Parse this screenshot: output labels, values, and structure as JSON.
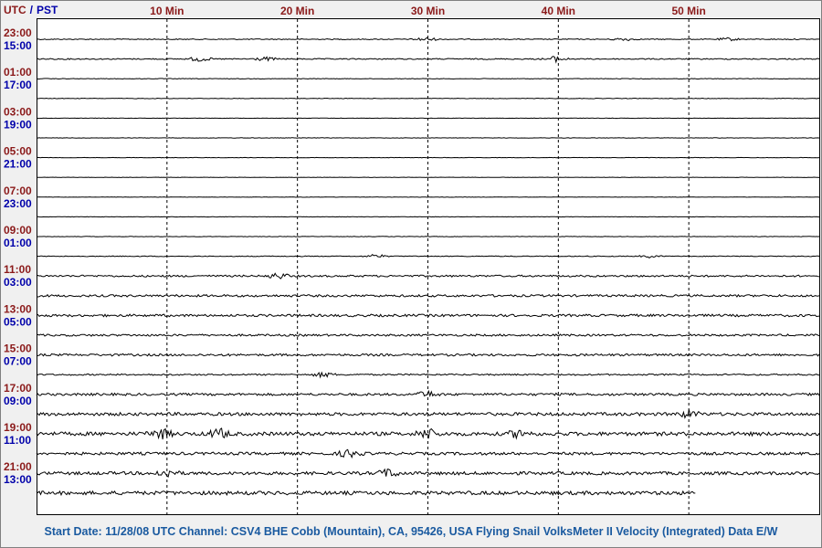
{
  "header": {
    "utc_label": "UTC",
    "sep": "/",
    "pst_label": "PST"
  },
  "colors": {
    "utc": "#8b1a1a",
    "pst": "#0000aa",
    "minute": "#8b1a1a",
    "trace": "#000000",
    "footer": "#1a5aa0"
  },
  "chart_data": {
    "type": "line",
    "title": "",
    "xlabel": "",
    "ylabel": "",
    "x_unit": "minutes",
    "xlim": [
      0,
      60
    ],
    "grid_minutes": [
      10,
      20,
      30,
      40,
      50
    ],
    "minute_labels": [
      "10 Min",
      "20 Min",
      "30 Min",
      "40 Min",
      "50 Min"
    ],
    "row_count": 24,
    "last_row_end_minute": 50.5,
    "hour_labels": [
      {
        "row": 0,
        "utc": "23:00",
        "pst": "15:00"
      },
      {
        "row": 2,
        "utc": "01:00",
        "pst": "17:00"
      },
      {
        "row": 4,
        "utc": "03:00",
        "pst": "19:00"
      },
      {
        "row": 6,
        "utc": "05:00",
        "pst": "21:00"
      },
      {
        "row": 8,
        "utc": "07:00",
        "pst": "23:00"
      },
      {
        "row": 10,
        "utc": "09:00",
        "pst": "01:00"
      },
      {
        "row": 12,
        "utc": "11:00",
        "pst": "03:00"
      },
      {
        "row": 14,
        "utc": "13:00",
        "pst": "05:00"
      },
      {
        "row": 16,
        "utc": "15:00",
        "pst": "07:00"
      },
      {
        "row": 18,
        "utc": "17:00",
        "pst": "09:00"
      },
      {
        "row": 20,
        "utc": "19:00",
        "pst": "11:00"
      },
      {
        "row": 22,
        "utc": "21:00",
        "pst": "13:00"
      }
    ],
    "row_noise_amplitude": [
      0.5,
      0.6,
      0.3,
      0.3,
      0.2,
      0.2,
      0.2,
      0.2,
      0.2,
      0.2,
      0.2,
      0.4,
      1.0,
      1.2,
      1.3,
      1.1,
      1.2,
      0.8,
      1.3,
      1.7,
      2.0,
      1.5,
      1.7,
      2.0
    ],
    "events": [
      {
        "row": 0,
        "minute": 29.8,
        "amplitude": 2.0
      },
      {
        "row": 0,
        "minute": 45,
        "amplitude": 1.5
      },
      {
        "row": 0,
        "minute": 53,
        "amplitude": 1.5
      },
      {
        "row": 1,
        "minute": 12.5,
        "amplitude": 2.5
      },
      {
        "row": 1,
        "minute": 17.5,
        "amplitude": 2.0
      },
      {
        "row": 1,
        "minute": 39.8,
        "amplitude": 3.0
      },
      {
        "row": 11,
        "minute": 26,
        "amplitude": 2.0
      },
      {
        "row": 11,
        "minute": 47,
        "amplitude": 1.5
      },
      {
        "row": 12,
        "minute": 18.5,
        "amplitude": 3.0
      },
      {
        "row": 17,
        "minute": 22,
        "amplitude": 2.5
      },
      {
        "row": 18,
        "minute": 30,
        "amplitude": 3.0
      },
      {
        "row": 19,
        "minute": 50,
        "amplitude": 3.5
      },
      {
        "row": 20,
        "minute": 9.5,
        "amplitude": 5.0
      },
      {
        "row": 20,
        "minute": 14,
        "amplitude": 5.0
      },
      {
        "row": 20,
        "minute": 30,
        "amplitude": 5.0
      },
      {
        "row": 20,
        "minute": 37,
        "amplitude": 4.0
      },
      {
        "row": 21,
        "minute": 24,
        "amplitude": 4.0
      },
      {
        "row": 22,
        "minute": 10,
        "amplitude": 4.0
      },
      {
        "row": 22,
        "minute": 27,
        "amplitude": 4.0
      }
    ]
  },
  "footer": {
    "text": "Start Date: 11/28/08 UTC Channel: CSV4  BHE  Cobb (Mountain), CA, 95426, USA  Flying Snail VolksMeter II Velocity (Integrated) Data E/W"
  }
}
